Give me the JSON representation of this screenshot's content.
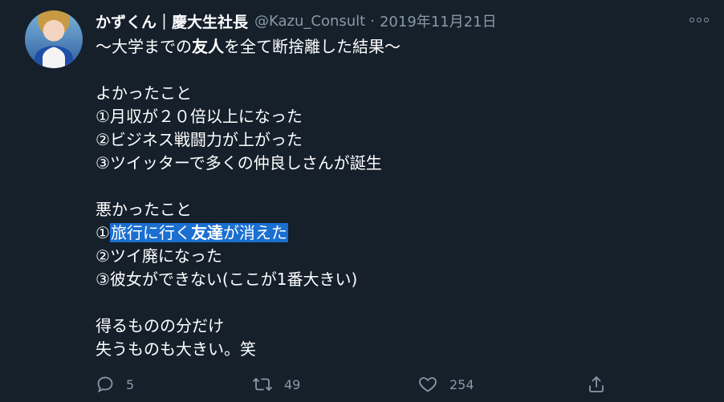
{
  "tweet": {
    "display_name": "かずくん｜慶大生社長",
    "handle": "@Kazu_Consult",
    "separator": "·",
    "date": "2019年11月21日",
    "title_parts": {
      "a": "〜大学までの",
      "b": "友人",
      "c": "を全て断捨離した結果〜"
    },
    "good_heading": "よかったこと",
    "good_1": "①月収が２０倍以上になった",
    "good_2": "②ビジネス戦闘力が上がった",
    "good_3": "③ツイッターで多くの仲良しさんが誕生",
    "bad_heading": "悪かったこと",
    "bad_1_parts": {
      "prefix": "①",
      "a": "旅行に行く",
      "b": "友達",
      "c": "が消えた"
    },
    "bad_2": "②ツイ廃になった",
    "bad_3": "③彼女ができない(ここが1番大きい)",
    "closing_1": "得るものの分だけ",
    "closing_2": "失うものも大きい。笑"
  },
  "actions": {
    "reply_count": "5",
    "retweet_count": "49",
    "like_count": "254"
  },
  "icons": {
    "more": "more-icon",
    "reply": "reply-icon",
    "retweet": "retweet-icon",
    "like": "heart-icon",
    "share": "share-icon"
  },
  "colors": {
    "background": "#15202b",
    "secondary_text": "#8899a6",
    "highlight": "#1a6fd0"
  }
}
